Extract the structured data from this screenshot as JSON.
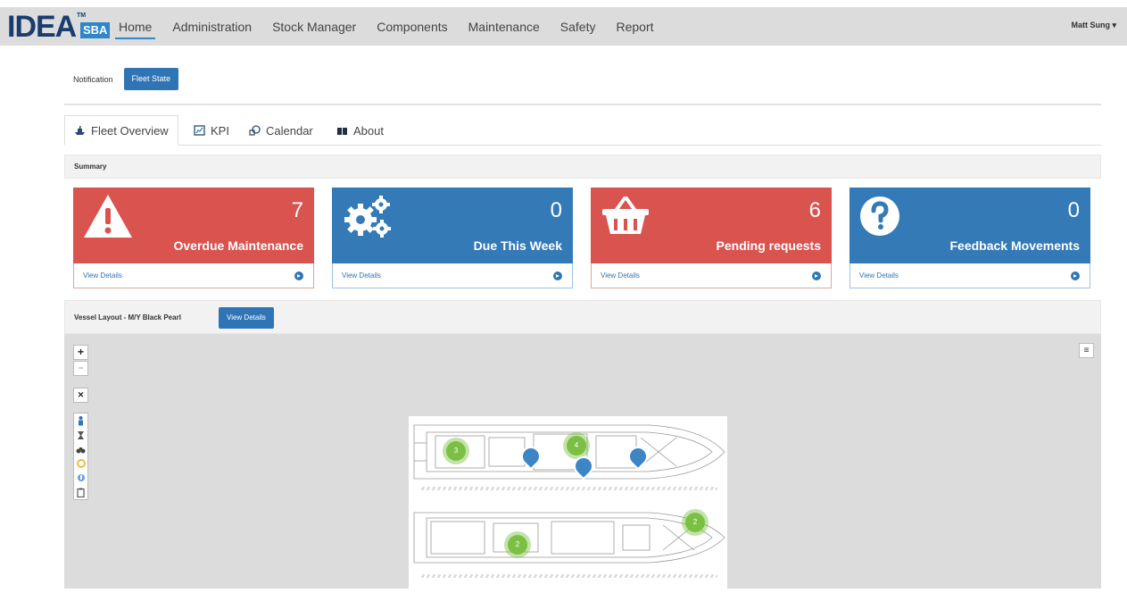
{
  "brand": {
    "name": "IDEA",
    "tm": "TM",
    "badge": "SBA"
  },
  "nav": {
    "items": [
      "Home",
      "Administration",
      "Stock Manager",
      "Components",
      "Maintenance",
      "Safety",
      "Report"
    ],
    "active": "Home",
    "user": "Matt Sung"
  },
  "subnav": {
    "notification": "Notification",
    "fleet_state": "Fleet State"
  },
  "tabs": [
    {
      "label": "Fleet Overview",
      "icon": "ship-icon"
    },
    {
      "label": "KPI",
      "icon": "chart-icon"
    },
    {
      "label": "Calendar",
      "icon": "calendar-icon"
    },
    {
      "label": "About",
      "icon": "book-icon"
    }
  ],
  "summary": {
    "title": "Summary",
    "cards": [
      {
        "value": "7",
        "label": "Overdue Maintenance",
        "link": "View Details",
        "icon": "warning-icon",
        "color": "#d9534f"
      },
      {
        "value": "0",
        "label": "Due This Week",
        "link": "View Details",
        "icon": "gears-icon",
        "color": "#337ab7"
      },
      {
        "value": "6",
        "label": "Pending requests",
        "link": "View Details",
        "icon": "basket-icon",
        "color": "#d9534f"
      },
      {
        "value": "0",
        "label": "Feedback Movements",
        "link": "View Details",
        "icon": "question-icon",
        "color": "#337ab7"
      }
    ]
  },
  "vessel": {
    "title": "Vessel Layout - M/Y Black Pearl",
    "button": "View Details",
    "controls": {
      "zoom_in": "+",
      "zoom_out": "−",
      "fullscreen": "✕",
      "menu": "≡"
    },
    "clusters": [
      "3",
      "4",
      "2",
      "2"
    ]
  }
}
